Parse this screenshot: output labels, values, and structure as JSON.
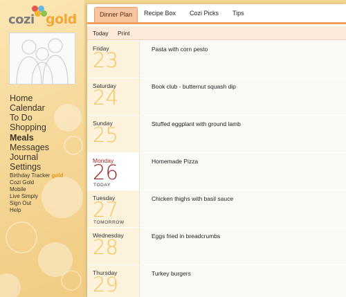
{
  "logo": {
    "part1": "cozi",
    "part2": "gold"
  },
  "colors": {
    "accent": "#f5a05f",
    "tab_active_bg": "#f7c6a0",
    "today_red": "#9b1f1f",
    "date_gold": "#f4c35a"
  },
  "nav": {
    "main": [
      {
        "label": "Home",
        "active": false
      },
      {
        "label": "Calendar",
        "active": false
      },
      {
        "label": "To Do",
        "active": false
      },
      {
        "label": "Shopping",
        "active": false
      },
      {
        "label": "Meals",
        "active": true
      },
      {
        "label": "Messages",
        "active": false
      },
      {
        "label": "Journal",
        "active": false
      },
      {
        "label": "Settings",
        "active": false
      }
    ],
    "birthday_tracker": "Birthday Tracker",
    "birthday_tracker_tag": "gold",
    "secondary": [
      "Cozi Gold",
      "Mobile",
      "Live Simply",
      "Sign Out",
      "Help"
    ]
  },
  "tabs": [
    {
      "label": "Dinner Plan",
      "active": true
    },
    {
      "label": "Recipe Box",
      "active": false
    },
    {
      "label": "Cozi Picks",
      "active": false
    },
    {
      "label": "Tips",
      "active": false
    }
  ],
  "toolbar": {
    "today_label": "Today",
    "print_label": "Print"
  },
  "days": [
    {
      "dayname": "Friday",
      "num": "23",
      "label": "",
      "meal": "Pasta with corn pesto",
      "today": false
    },
    {
      "dayname": "Saturday",
      "num": "24",
      "label": "",
      "meal": "Book club - butternut squash dip",
      "today": false
    },
    {
      "dayname": "Sunday",
      "num": "25",
      "label": "",
      "meal": "Stuffed eggplant with ground lamb",
      "today": false
    },
    {
      "dayname": "Monday",
      "num": "26",
      "label": "TODAY",
      "meal": "Homemade Pizza",
      "today": true
    },
    {
      "dayname": "Tuesday",
      "num": "27",
      "label": "TOMORROW",
      "meal": "Chicken thighs with basil sauce",
      "today": false
    },
    {
      "dayname": "Wednesday",
      "num": "28",
      "label": "",
      "meal": "Eggs fried in breadcrumbs",
      "today": false
    },
    {
      "dayname": "Thursday",
      "num": "29",
      "label": "",
      "meal": "Turkey burgers",
      "today": false
    }
  ]
}
